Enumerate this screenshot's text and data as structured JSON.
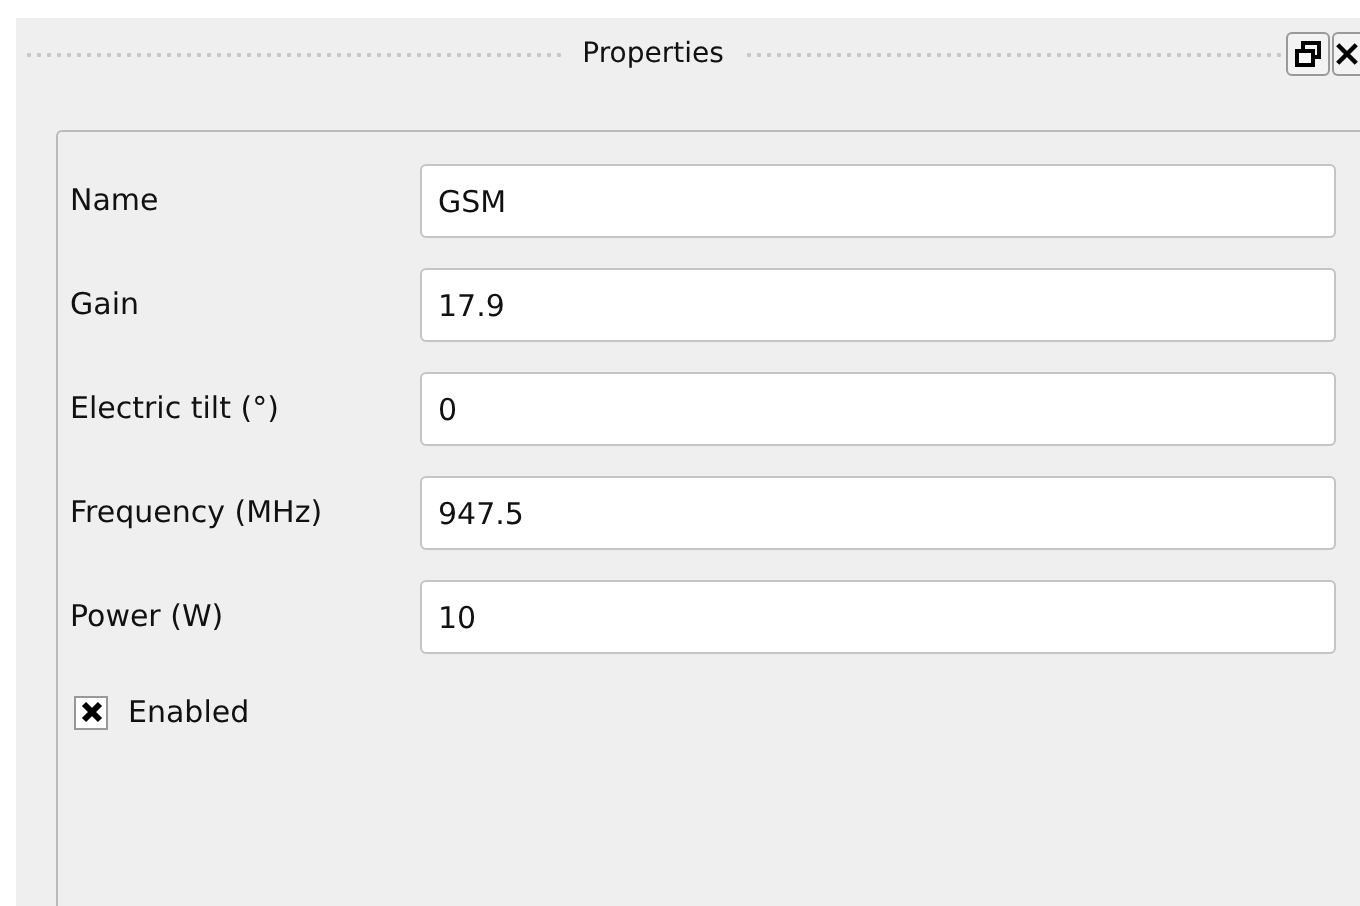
{
  "panel": {
    "title": "Properties"
  },
  "fields": [
    {
      "label": "Name",
      "value": "GSM"
    },
    {
      "label": "Gain",
      "value": "17.9"
    },
    {
      "label": "Electric tilt (°)",
      "value": "0"
    },
    {
      "label": "Frequency (MHz)",
      "value": "947.5"
    },
    {
      "label": "Power (W)",
      "value": "10"
    }
  ],
  "enabled": {
    "label": "Enabled",
    "checked": true
  }
}
